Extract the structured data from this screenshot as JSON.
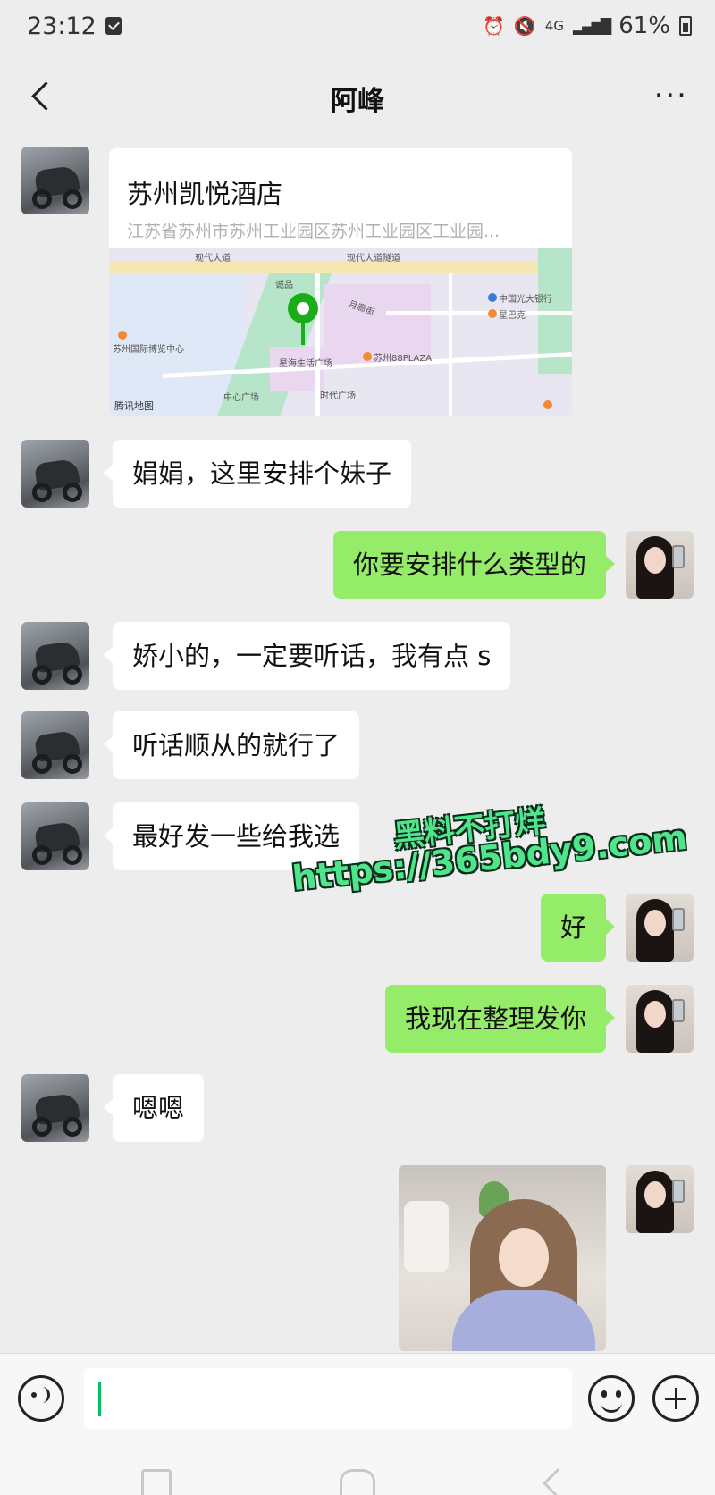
{
  "status_bar": {
    "time": "23:12",
    "network": "4G",
    "battery": "61%",
    "icons": [
      "notification-check-icon",
      "alarm-icon",
      "mute-icon",
      "network-4g-icon",
      "signal-icon",
      "battery-icon"
    ]
  },
  "nav": {
    "title": "阿峰",
    "more": "···"
  },
  "location": {
    "name": "苏州凯悦酒店",
    "address": "江苏省苏州市苏州工业园区苏州工业园区工业园...",
    "map": {
      "labels": [
        "现代大道",
        "现代大道隧道",
        "中国光大银行",
        "星巴克",
        "苏州国际博览中心",
        "诚品",
        "星海生活广场",
        "苏州88PLAZA",
        "时代广场",
        "中心广场",
        "月廊街"
      ],
      "brand": "腾讯地图"
    }
  },
  "messages": [
    {
      "side": "in",
      "text": "娟娟，这里安排个妹子"
    },
    {
      "side": "out",
      "text": "你要安排什么类型的"
    },
    {
      "side": "in",
      "text": "娇小的，一定要听话，我有点 s"
    },
    {
      "side": "in",
      "text": "听话顺从的就行了"
    },
    {
      "side": "in",
      "text": "最好发一些给我选"
    },
    {
      "side": "out",
      "text": "好"
    },
    {
      "side": "out",
      "text": "我现在整理发你"
    },
    {
      "side": "in",
      "text": "嗯嗯"
    }
  ],
  "watermark": {
    "line1": "黑料不打烊",
    "line2": "https://365bdy9.com"
  },
  "input_bar": {
    "value": ""
  },
  "colors": {
    "background": "#ededed",
    "outgoing_bubble": "#95ec69",
    "incoming_bubble": "#ffffff",
    "accent": "#07c160"
  }
}
